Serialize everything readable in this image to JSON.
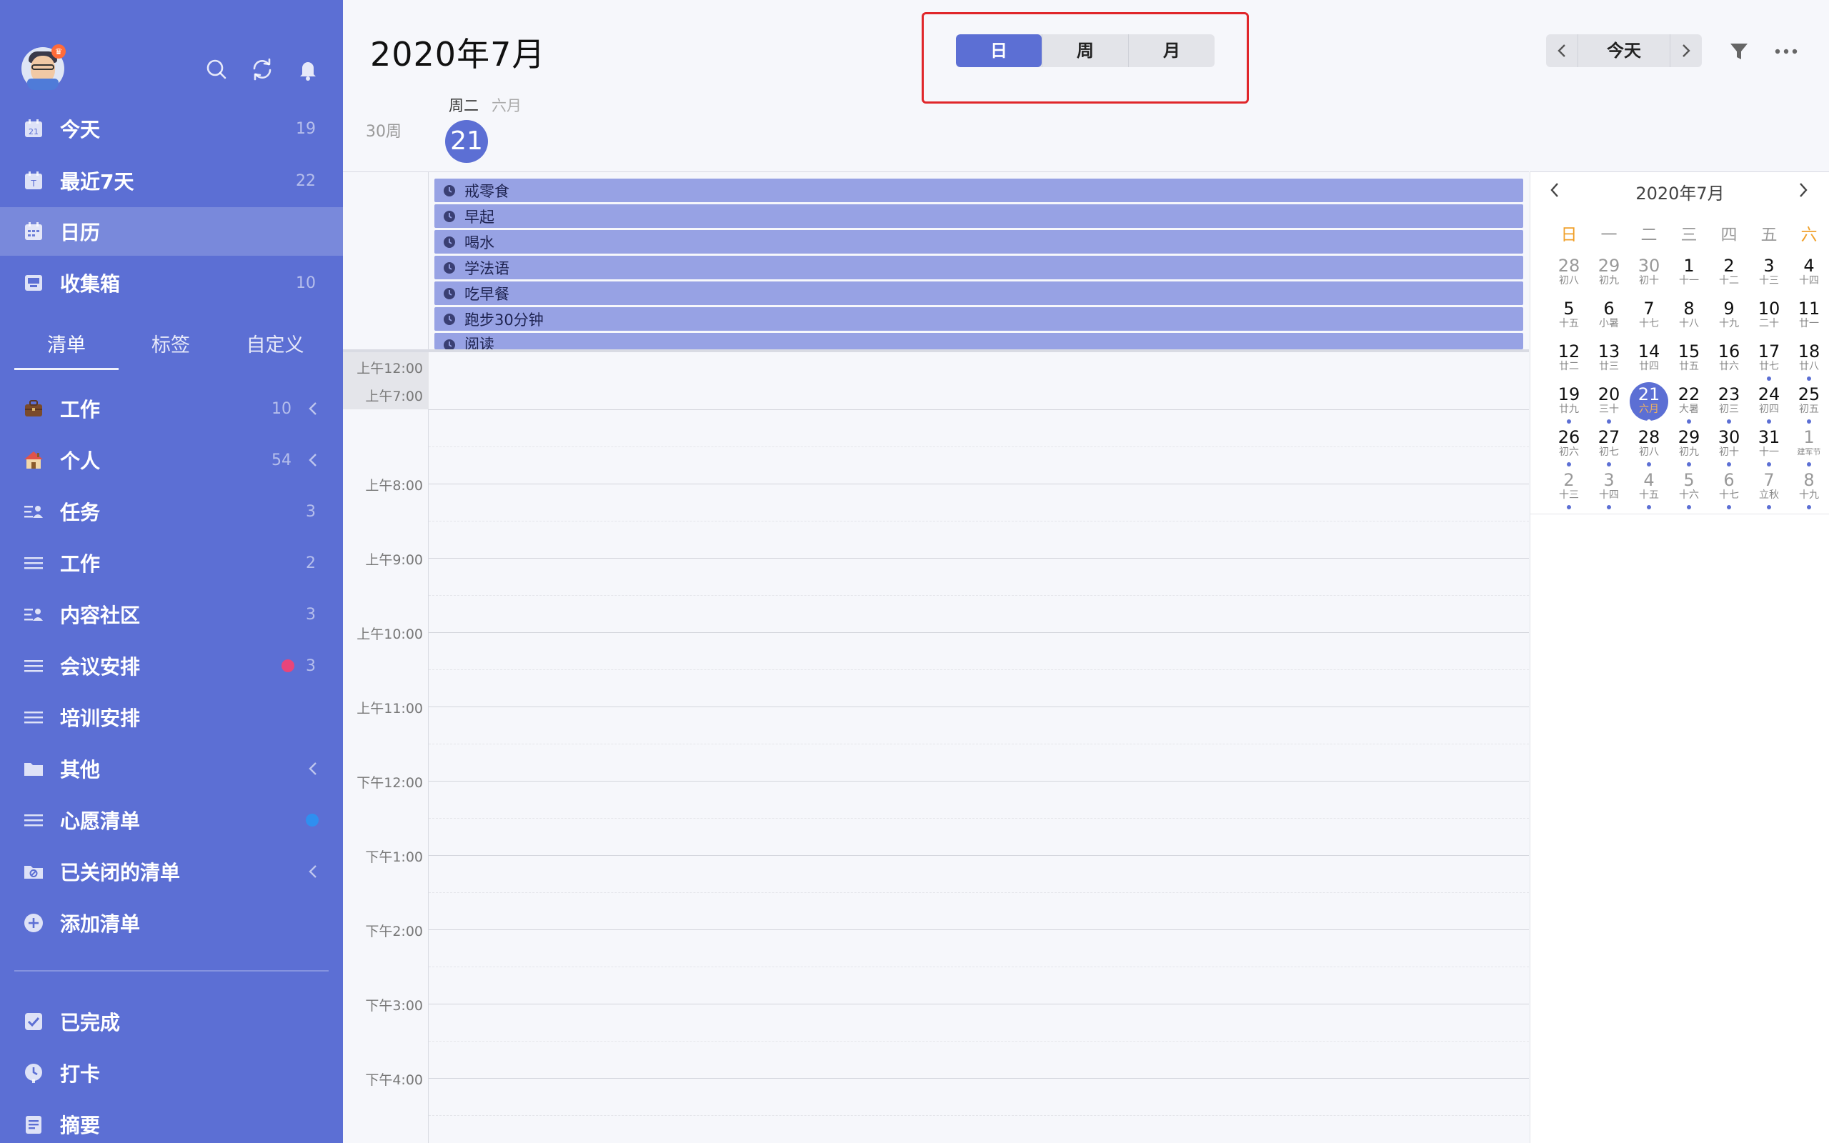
{
  "sidebar": {
    "smart_lists": [
      {
        "label": "今天",
        "count": "19",
        "icon": "calendar-today-icon"
      },
      {
        "label": "最近7天",
        "count": "22",
        "icon": "calendar-week-icon"
      },
      {
        "label": "日历",
        "count": "",
        "icon": "calendar-grid-icon",
        "active": true
      },
      {
        "label": "收集箱",
        "count": "10",
        "icon": "inbox-icon"
      }
    ],
    "tabs": [
      "清单",
      "标签",
      "自定义"
    ],
    "lists": [
      {
        "label": "工作",
        "count": "10",
        "icon": "briefcase-emoji-icon",
        "collapsible": true
      },
      {
        "label": "个人",
        "count": "54",
        "icon": "house-emoji-icon",
        "collapsible": true
      },
      {
        "label": "任务",
        "count": "3",
        "icon": "shared-list-icon"
      },
      {
        "label": "工作",
        "count": "2",
        "icon": "list-icon"
      },
      {
        "label": "内容社区",
        "count": "3",
        "icon": "shared-list-icon"
      },
      {
        "label": "会议安排",
        "count": "3",
        "icon": "list-icon",
        "dot_color": "#e8457a"
      },
      {
        "label": "培训安排",
        "count": "",
        "icon": "list-icon"
      },
      {
        "label": "其他",
        "count": "",
        "icon": "folder-icon",
        "collapsible": true
      },
      {
        "label": "心愿清单",
        "count": "",
        "icon": "list-icon",
        "dot_color": "#2f8ff0"
      },
      {
        "label": "已关闭的清单",
        "count": "",
        "icon": "closed-folder-icon",
        "collapsible": true
      },
      {
        "label": "添加清单",
        "count": "",
        "icon": "plus-circle-icon"
      }
    ],
    "bottom": [
      {
        "label": "已完成",
        "icon": "checkbox-icon"
      },
      {
        "label": "打卡",
        "icon": "habit-clock-icon"
      },
      {
        "label": "摘要",
        "icon": "summary-icon"
      }
    ]
  },
  "header": {
    "title": "2020年7月",
    "views": [
      "日",
      "周",
      "月"
    ],
    "active_view": "日",
    "today_label": "今天"
  },
  "day": {
    "week_label": "30周",
    "weekday": "周二",
    "lunar_month": "六月",
    "date": "21"
  },
  "all_day_events": [
    "戒零食",
    "早起",
    "喝水",
    "学法语",
    "吃早餐",
    "跑步30分钟",
    "阅读"
  ],
  "time_labels": [
    "上午12:00",
    "上午7:00",
    "上午8:00",
    "上午9:00",
    "上午10:00",
    "上午11:00",
    "下午12:00",
    "下午1:00",
    "下午2:00",
    "下午3:00",
    "下午4:00"
  ],
  "mini_calendar": {
    "title": "2020年7月",
    "weekdays": [
      "日",
      "一",
      "二",
      "三",
      "四",
      "五",
      "六"
    ],
    "weeks": [
      [
        {
          "d": "28",
          "l": "初八",
          "o": true
        },
        {
          "d": "29",
          "l": "初九",
          "o": true
        },
        {
          "d": "30",
          "l": "初十",
          "o": true
        },
        {
          "d": "1",
          "l": "十一"
        },
        {
          "d": "2",
          "l": "十二"
        },
        {
          "d": "3",
          "l": "十三"
        },
        {
          "d": "4",
          "l": "十四"
        }
      ],
      [
        {
          "d": "5",
          "l": "十五"
        },
        {
          "d": "6",
          "l": "小暑"
        },
        {
          "d": "7",
          "l": "十七"
        },
        {
          "d": "8",
          "l": "十八"
        },
        {
          "d": "9",
          "l": "十九"
        },
        {
          "d": "10",
          "l": "二十"
        },
        {
          "d": "11",
          "l": "廿一"
        }
      ],
      [
        {
          "d": "12",
          "l": "廿二"
        },
        {
          "d": "13",
          "l": "廿三"
        },
        {
          "d": "14",
          "l": "廿四"
        },
        {
          "d": "15",
          "l": "廿五"
        },
        {
          "d": "16",
          "l": "廿六"
        },
        {
          "d": "17",
          "l": "廿七",
          "dot": true
        },
        {
          "d": "18",
          "l": "廿八",
          "dot": true
        }
      ],
      [
        {
          "d": "19",
          "l": "廿九",
          "dot": true
        },
        {
          "d": "20",
          "l": "三十",
          "dot": true
        },
        {
          "d": "21",
          "l": "六月",
          "dot": true,
          "sel": true
        },
        {
          "d": "22",
          "l": "大暑",
          "dot": true
        },
        {
          "d": "23",
          "l": "初三",
          "dot": true
        },
        {
          "d": "24",
          "l": "初四",
          "dot": true
        },
        {
          "d": "25",
          "l": "初五",
          "dot": true
        }
      ],
      [
        {
          "d": "26",
          "l": "初六",
          "dot": true
        },
        {
          "d": "27",
          "l": "初七",
          "dot": true
        },
        {
          "d": "28",
          "l": "初八",
          "dot": true
        },
        {
          "d": "29",
          "l": "初九",
          "dot": true
        },
        {
          "d": "30",
          "l": "初十",
          "dot": true
        },
        {
          "d": "31",
          "l": "十一",
          "dot": true
        },
        {
          "d": "1",
          "l": "建军节",
          "o": true,
          "dot": true
        }
      ],
      [
        {
          "d": "2",
          "l": "十三",
          "o": true,
          "dot": true
        },
        {
          "d": "3",
          "l": "十四",
          "o": true,
          "dot": true
        },
        {
          "d": "4",
          "l": "十五",
          "o": true,
          "dot": true
        },
        {
          "d": "5",
          "l": "十六",
          "o": true,
          "dot": true
        },
        {
          "d": "6",
          "l": "十七",
          "o": true,
          "dot": true
        },
        {
          "d": "7",
          "l": "立秋",
          "o": true,
          "dot": true
        },
        {
          "d": "8",
          "l": "十九",
          "o": true,
          "dot": true
        }
      ]
    ]
  },
  "colors": {
    "accent": "#5c6fd4",
    "sidebar_bg": "#5c6fd4",
    "event_bg": "#97a2e4",
    "highlight_border": "#e0262a",
    "weekend": "#f0a02a"
  }
}
